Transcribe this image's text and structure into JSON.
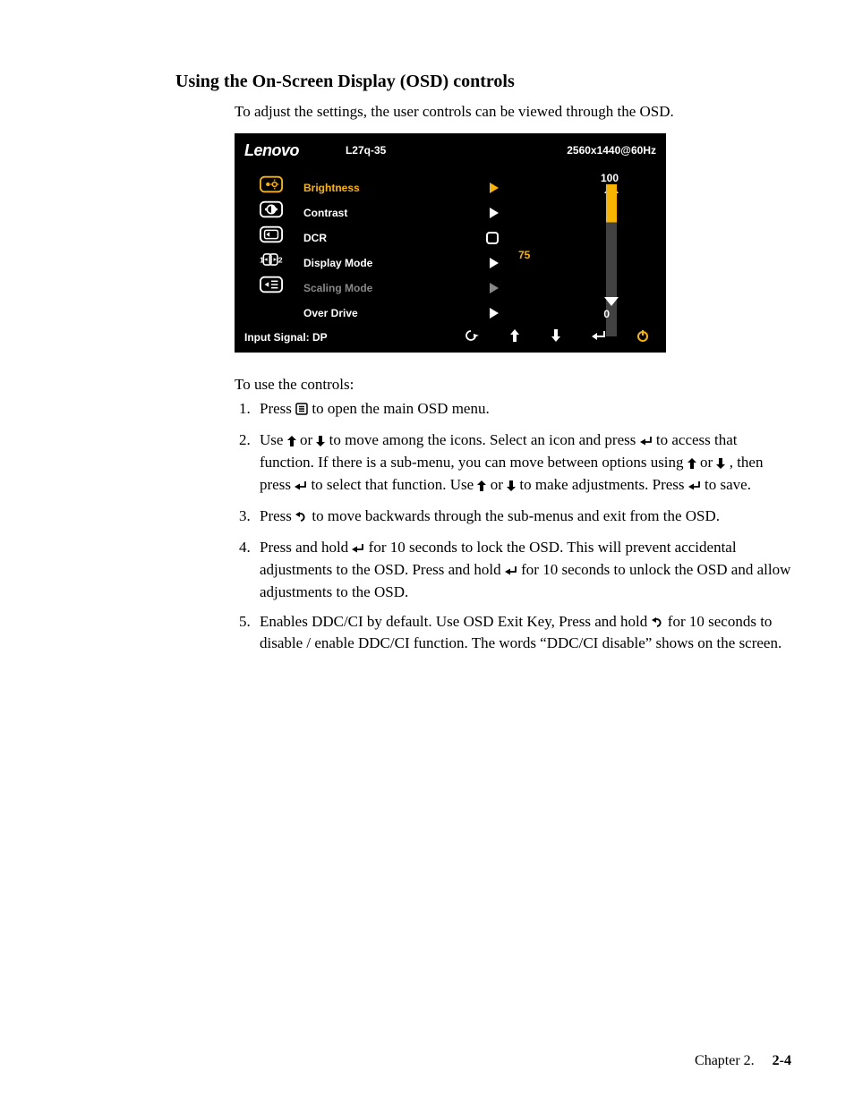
{
  "section_title": "Using the On-Screen Display (OSD) controls",
  "intro": "To adjust the settings, the user controls can be viewed through the OSD.",
  "osd": {
    "brand": "Lenovo",
    "model": "L27q-35",
    "resolution": "2560x1440@60Hz",
    "menu": [
      {
        "label": "Brightness",
        "style": "sel",
        "ind": "chev-sel"
      },
      {
        "label": "Contrast",
        "style": "norm",
        "ind": "chev"
      },
      {
        "label": "DCR",
        "style": "norm",
        "ind": "square"
      },
      {
        "label": "Display Mode",
        "style": "norm",
        "ind": "chev"
      },
      {
        "label": "Scaling Mode",
        "style": "dim",
        "ind": "chev-dim"
      },
      {
        "label": "Over Drive",
        "style": "norm",
        "ind": "chev"
      }
    ],
    "slider": {
      "max": "100",
      "mid": "75",
      "min": "0"
    },
    "input_signal": "Input Signal: DP"
  },
  "to_use": "To use the controls:",
  "steps": [
    {
      "pre": "Press ",
      "icon": "menu",
      "post": " to open the main OSD menu."
    },
    {
      "text": "Use {up} or {down} to move among the icons. Select an icon and press {enter} to access that function. If there is a sub-menu, you can move between options using {up} or {down} , then press {enter} to select that function. Use {up} or {down} to make adjustments. Press {enter} to save."
    },
    {
      "pre": "Press ",
      "icon": "back",
      "post": " to move backwards through the sub-menus and exit from the OSD."
    },
    {
      "text": "Press and hold {enter} for 10 seconds to lock the OSD. This will prevent accidental adjustments to the OSD. Press and hold {enter} for 10 seconds to unlock the OSD and allow adjustments to the OSD."
    },
    {
      "text": "Enables DDC/CI by default. Use OSD Exit Key, Press and hold {back} for 10 seconds to disable / enable DDC/CI function. The words “DDC/CI disable” shows on the screen."
    }
  ],
  "footer": {
    "chapter": "Chapter 2.",
    "page": "2-4"
  }
}
